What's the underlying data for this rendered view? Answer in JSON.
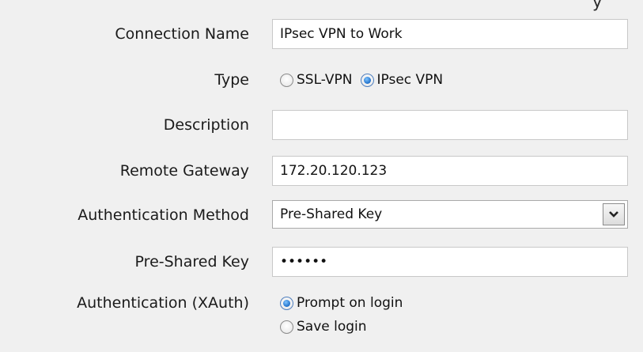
{
  "fragment_top": "y",
  "form": {
    "connection_name": {
      "label": "Connection Name",
      "value": "IPsec VPN to Work"
    },
    "type": {
      "label": "Type",
      "options": [
        "SSL-VPN",
        "IPsec VPN"
      ],
      "selected": "IPsec VPN"
    },
    "description": {
      "label": "Description",
      "value": ""
    },
    "remote_gateway": {
      "label": "Remote Gateway",
      "value": "172.20.120.123"
    },
    "auth_method": {
      "label": "Authentication Method",
      "value": "Pre-Shared Key"
    },
    "psk": {
      "label": "Pre-Shared Key",
      "masked_value": "••••••"
    },
    "xauth": {
      "label": "Authentication (XAuth)",
      "options": [
        "Prompt on login",
        "Save login"
      ],
      "selected": "Prompt on login"
    }
  }
}
